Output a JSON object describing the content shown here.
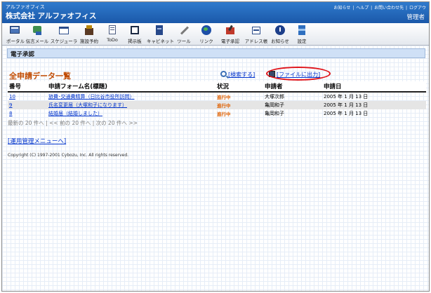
{
  "header": {
    "brand_small": "アルファオフィス",
    "brand_name": "株式会社 アルファオフィス",
    "links": [
      "お知らせ",
      "ヘルプ",
      "お問い合わせ先",
      "ログアウ"
    ],
    "separator": "|",
    "user": "管理者"
  },
  "toolbar": {
    "items": [
      {
        "label": "ポータル",
        "icon": "portal-icon"
      },
      {
        "label": "伝言メール",
        "icon": "message-mail-icon"
      },
      {
        "label": "スケジューラ",
        "icon": "scheduler-icon"
      },
      {
        "label": "施設予約",
        "icon": "facility-icon"
      },
      {
        "label": "ToDo",
        "icon": "todo-icon"
      },
      {
        "label": "掲示板",
        "icon": "bulletin-board-icon"
      },
      {
        "label": "キャビネット",
        "icon": "cabinet-icon"
      },
      {
        "label": "ツール",
        "icon": "tool-icon"
      },
      {
        "label": "リンク",
        "icon": "link-icon"
      },
      {
        "label": "電子承認",
        "icon": "approval-icon"
      },
      {
        "label": "アドレス帳",
        "icon": "address-book-icon"
      },
      {
        "label": "お知らせ",
        "icon": "notice-icon"
      },
      {
        "label": "設定",
        "icon": "settings-icon"
      }
    ]
  },
  "section": {
    "title": "電子承認"
  },
  "list": {
    "title": "全申請データ一覧",
    "search_label": "[検索する]",
    "export_label": "[ファイルに出力]",
    "columns": [
      "番号",
      "申請フォーム名(標題)",
      "状況",
      "申請者",
      "申請日"
    ],
    "rows": [
      {
        "number": "10",
        "form": "旅費･交通費精算（日比谷市役所訪問）",
        "status": "進行中",
        "applicant": "大塚次郎",
        "date": "2005 年 1 月 13 日"
      },
      {
        "number": "9",
        "form": "氏名変更届（大塚和子になります）",
        "status": "進行中",
        "applicant": "亀岡和子",
        "date": "2005 年 1 月 13 日"
      },
      {
        "number": "8",
        "form": "結婚届（結婚しました）",
        "status": "進行中",
        "applicant": "亀岡和子",
        "date": "2005 年 1 月 13 日"
      }
    ]
  },
  "paging": {
    "text": "最新の 20 件へ | << 前の 20 件へ | 次の 20 件へ >>"
  },
  "admin_menu": "[運用管理メニューへ]",
  "copyright": "Copyright (C) 1997-2001 Cybozu, Inc. All rights reserved.",
  "colors": {
    "header": "#1f62b4",
    "section_bar": "#cfe0f6",
    "title": "#c04a00",
    "status": "#e06000",
    "link": "#0033cc",
    "highlight": "#e0151b"
  }
}
